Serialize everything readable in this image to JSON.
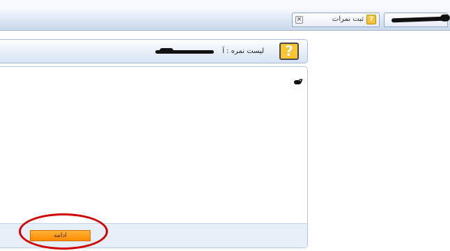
{
  "tabs": [
    {
      "label": "ثبت نمرات",
      "icon": "question-icon",
      "close_glyph": "×",
      "active": true
    },
    {
      "label": "",
      "icon": "",
      "active": false
    }
  ],
  "header": {
    "icon": "question-icon",
    "icon_glyph": "?",
    "title": "لیست نمره : آ"
  },
  "content": {
    "text": "7"
  },
  "footer": {
    "continue_label": "ادامه"
  },
  "colors": {
    "accent_button": "#ff9a1a",
    "annotation": "#d40000",
    "panel_border": "#a9bcd8"
  }
}
